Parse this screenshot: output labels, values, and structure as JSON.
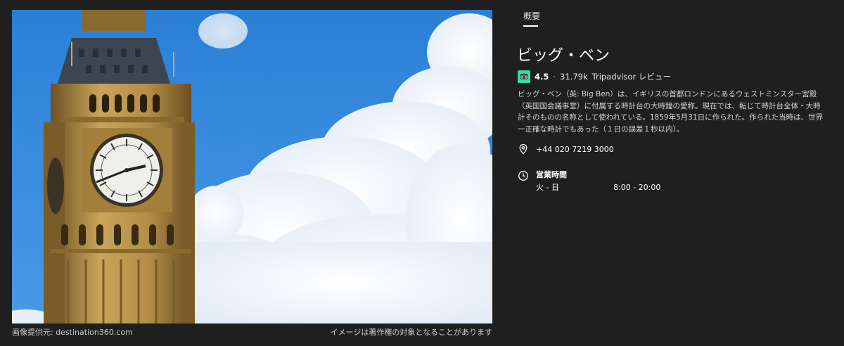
{
  "photo": {
    "alt_subject": "Big Ben clock tower",
    "credit": "画像提供元: destination360.com",
    "copyright_notice": "イメージは著作権の対象となることがあります"
  },
  "panel": {
    "tab_label": "概要",
    "title": "ビッグ・ベン",
    "rating": {
      "icon": "tripadvisor-owl-icon",
      "score": "4.5",
      "separator": "·",
      "count": "31.79k",
      "source": "Tripadvisor レビュー"
    },
    "description": "ビッグ・ベン（英: Big Ben）は、イギリスの首都ロンドンにあるウェストミンスター宮殿（英国国会議事堂）に付属する時計台の大時鐘の愛称。現在では、転じて時計台全体・大時計そのものの名称として使われている。1859年5月31日に作られた。作られた当時は、世界一正確な時計でもあった（１日の誤差１秒以内）。",
    "phone": {
      "icon": "location-pin-icon",
      "value": "+44 020 7219 3000"
    },
    "hours": {
      "icon": "clock-icon",
      "title": "営業時間",
      "days": "火 - 日",
      "time": "8:00 - 20:00"
    }
  },
  "colors": {
    "background": "#1f1f1f",
    "sky": "#2f82d8",
    "tripadvisor_green": "#34e0a1",
    "stone": "#b8924a"
  }
}
